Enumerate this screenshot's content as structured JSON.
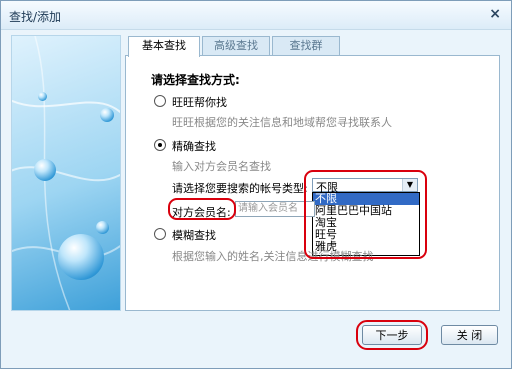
{
  "window": {
    "title": "查找/添加",
    "close_glyph": "×"
  },
  "tabs": [
    {
      "label": "基本查找",
      "active": true
    },
    {
      "label": "高级查找",
      "active": false
    },
    {
      "label": "查找群",
      "active": false
    }
  ],
  "form": {
    "heading": "请选择查找方式:",
    "option1": {
      "label": "旺旺帮你找",
      "desc": "旺旺根据您的关注信息和地域帮您寻找联系人",
      "selected": false
    },
    "option2": {
      "label": "精确查找",
      "desc": "输入对方会员名查找",
      "selected": true,
      "account_type_label": "请选择您要搜索的帐号类型:",
      "account_type_value": "不限",
      "account_type_options": [
        "不限",
        "阿里巴巴中国站",
        "淘宝",
        "旺号",
        "雅虎"
      ],
      "member_label": "对方会员名:",
      "member_placeholder": "请输入会员名"
    },
    "option3": {
      "label": "模糊查找",
      "desc": "根据您输入的姓名,关注信息进行模糊查找",
      "selected": false
    }
  },
  "buttons": {
    "next": "下一步",
    "close": "关  闭"
  },
  "colors": {
    "highlight": "#d9000d",
    "accent": "#2f97d6"
  }
}
